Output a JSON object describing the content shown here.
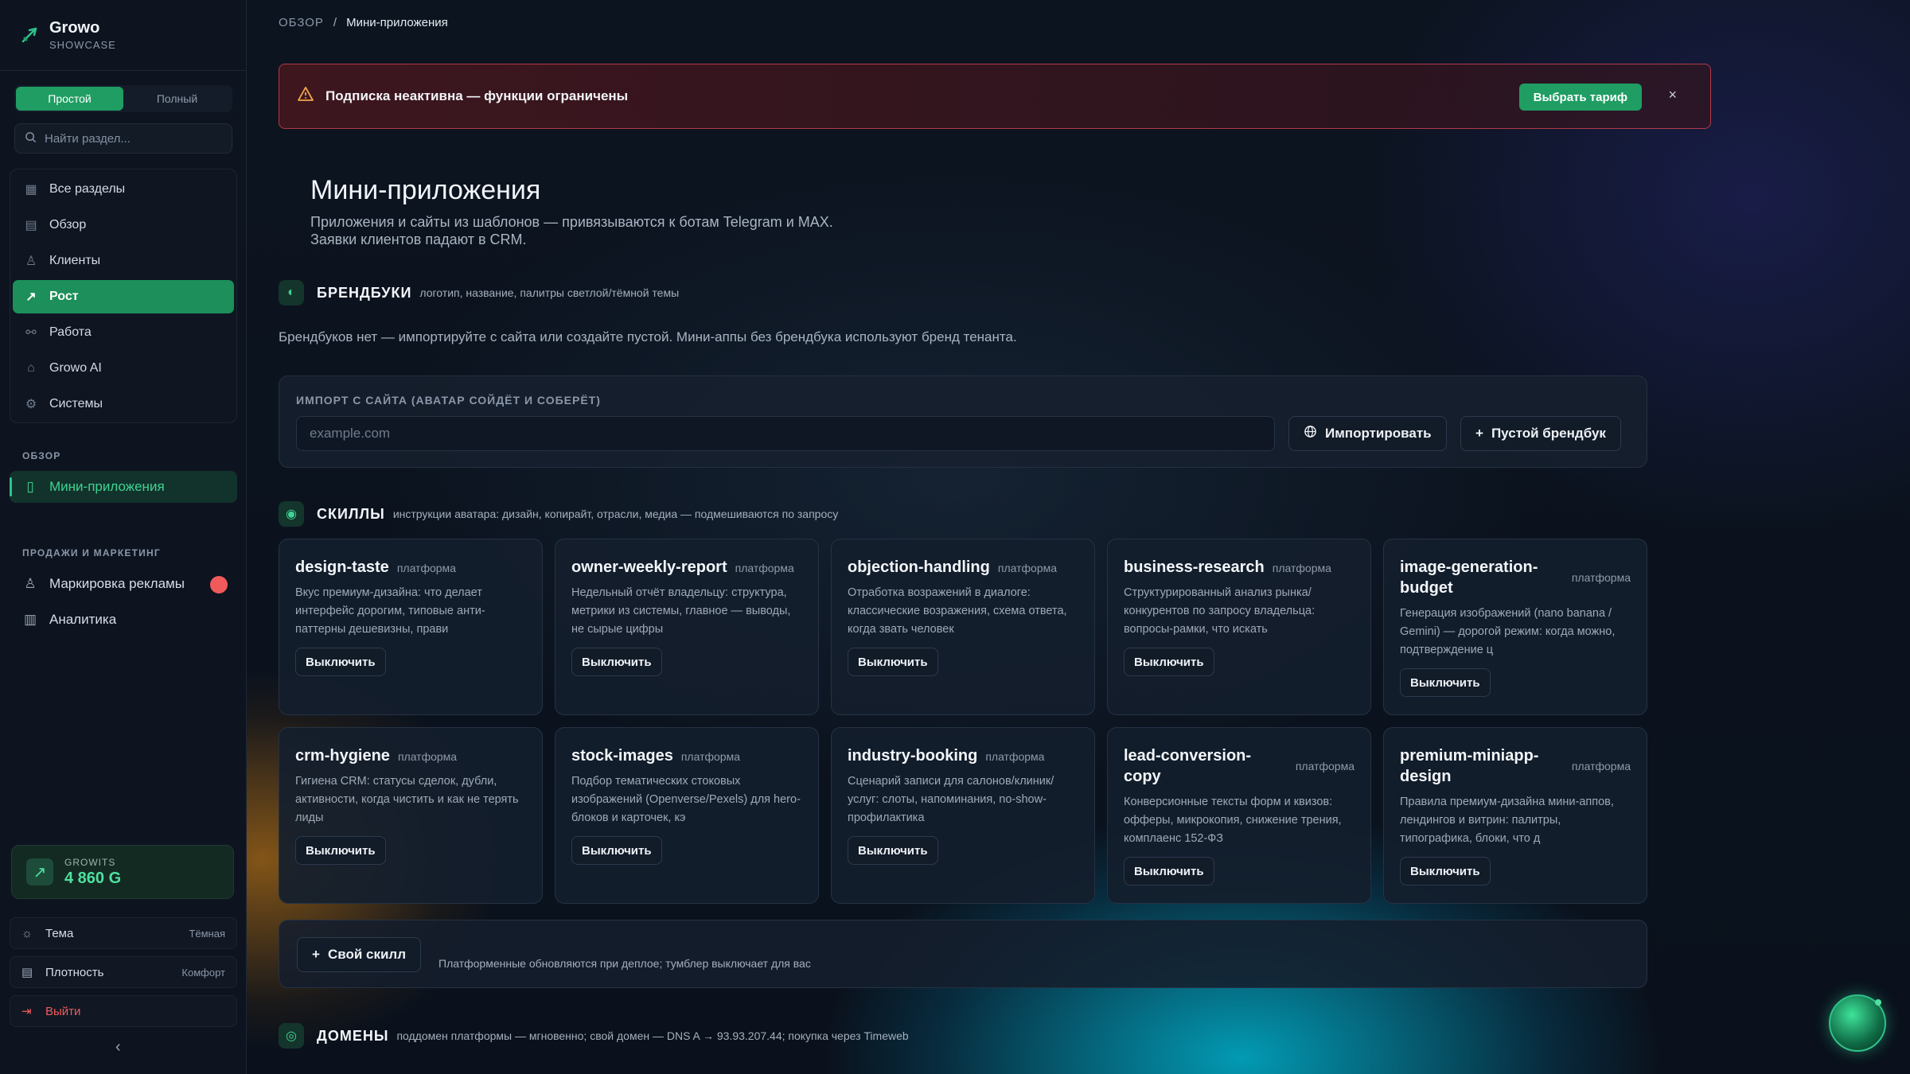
{
  "app": {
    "name": "Growo",
    "subtitle": "SHOWCASE"
  },
  "sidebar": {
    "modes": [
      "Простой",
      "Полный"
    ],
    "search_placeholder": "Найти раздел...",
    "nav": [
      {
        "label": "Все разделы",
        "icon": "grid-icon"
      },
      {
        "label": "Обзор",
        "icon": "dashboard-icon"
      },
      {
        "label": "Клиенты",
        "icon": "user-icon"
      },
      {
        "label": "Рост",
        "icon": "trending-up-icon"
      },
      {
        "label": "Работа",
        "icon": "workflow-icon"
      },
      {
        "label": "Growo AI",
        "icon": "bot-icon"
      },
      {
        "label": "Системы",
        "icon": "gear-icon"
      }
    ],
    "section_overview": "ОБЗОР",
    "overview_items": [
      {
        "label": "Мини-приложения",
        "icon": "phone-icon"
      }
    ],
    "section_sales": "ПРОДАЖИ И МАРКЕТИНГ",
    "sales_items": [
      {
        "label": "Маркировка рекламы",
        "icon": "stamp-icon"
      },
      {
        "label": "Аналитика",
        "icon": "bar-chart-icon"
      }
    ],
    "growits": {
      "label": "GROWITS",
      "value": "4 860 G"
    },
    "settings": [
      {
        "label": "Тема",
        "value": "Тёмная"
      },
      {
        "label": "Плотность",
        "value": "Комфорт"
      }
    ],
    "logout": "Выйти"
  },
  "breadcrumb": {
    "first": "ОБЗОР",
    "sep": "/",
    "last": "Мини-приложения"
  },
  "alert": {
    "text": "Подписка неактивна — функции ограничены",
    "button": "Выбрать тариф",
    "close": "×"
  },
  "page": {
    "title": "Мини-приложения",
    "desc_line1": "Приложения и сайты из шаблонов — привязываются к ботам Telegram и MAX.",
    "desc_line2": "Заявки клиентов падают в CRM."
  },
  "brandbooks": {
    "title": "БРЕНДБУКИ",
    "note": "логотип, название, палитры светлой/тёмной темы",
    "empty": "Брендбуков нет — импортируйте с сайта или создайте пустой. Мини-аппы без брендбука используют бренд тенанта.",
    "import_label": "ИМПОРТ С САЙТА (АВАТАР СОЙДЁТ И СОБЕРЁТ)",
    "import_placeholder": "example.com",
    "import_button": "Импортировать",
    "empty_button": "Пустой брендбук"
  },
  "skills": {
    "title": "СКИЛЛЫ",
    "note": "инструкции аватара: дизайн, копирайт, отрасли, медиа — подмешиваются по запросу",
    "items": [
      {
        "name": "design-taste",
        "tag": "платформа",
        "desc": "Вкус премиум-дизайна: что делает интерфейс дорогим, типовые анти-паттерны дешевизны, прави",
        "button": "Выключить"
      },
      {
        "name": "owner-weekly-report",
        "tag": "платформа",
        "desc": "Недельный отчёт владельцу: структура, метрики из системы, главное — выводы, не сырые цифры",
        "button": "Выключить"
      },
      {
        "name": "objection-handling",
        "tag": "платформа",
        "desc": "Отработка возражений в диалоге: классические возражения, схема ответа, когда звать человек",
        "button": "Выключить"
      },
      {
        "name": "business-research",
        "tag": "платформа",
        "desc": "Структурированный анализ рынка/конкурентов по запросу владельца: вопросы-рамки, что искать",
        "button": "Выключить"
      },
      {
        "name": "image-generation-budget",
        "tag": "платформа",
        "desc": "Генерация изображений (nano banana / Gemini) — дорогой режим: когда можно, подтверждение ц",
        "button": "Выключить"
      },
      {
        "name": "crm-hygiene",
        "tag": "платформа",
        "desc": "Гигиена CRM: статусы сделок, дубли, активности, когда чистить и как не терять лиды",
        "button": "Выключить"
      },
      {
        "name": "stock-images",
        "tag": "платформа",
        "desc": "Подбор тематических стоковых изображений (Openverse/Pexels) для hero-блоков и карточек, кэ",
        "button": "Выключить"
      },
      {
        "name": "industry-booking",
        "tag": "платформа",
        "desc": "Сценарий записи для салонов/клиник/услуг: слоты, напоминания, no-show-профилактика",
        "button": "Выключить"
      },
      {
        "name": "lead-conversion-copy",
        "tag": "платформа",
        "desc": "Конверсионные тексты форм и квизов: офферы, микрокопия, снижение трения, комплаенс 152-ФЗ",
        "button": "Выключить"
      },
      {
        "name": "premium-miniapp-design",
        "tag": "платформа",
        "desc": "Правила премиум-дизайна мини-аппов, лендингов и витрин: палитры, типографика, блоки, что д",
        "button": "Выключить"
      }
    ],
    "custom_button": "Свой скилл",
    "custom_note": "Платформенные обновляются при деплое; тумблер выключает для вас"
  },
  "domains": {
    "title": "ДОМЕНЫ",
    "note": "поддомен платформы — мгновенно; свой домен — DNS A → 93.93.207.44; покупка через Timeweb"
  },
  "colors": {
    "accent": "#1f9d63",
    "accent_text": "#3fd393",
    "danger": "#ef5c5c",
    "alert_border": "#b43a48"
  }
}
